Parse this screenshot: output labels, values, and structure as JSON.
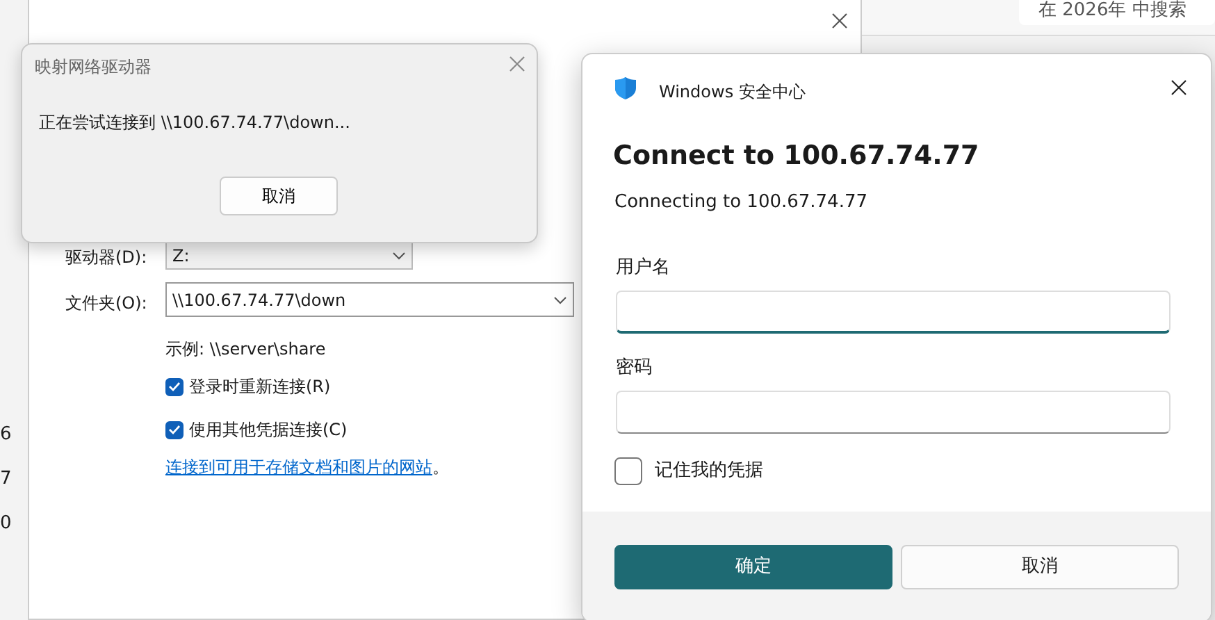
{
  "background": {
    "search_field": {
      "placeholder": "在 2026年 中搜索"
    },
    "side_numbers": [
      "6",
      "7",
      "0"
    ]
  },
  "map_drive_window": {
    "drive_label": "驱动器(D):",
    "drive_value": "Z:",
    "folder_label": "文件夹(O):",
    "folder_value": "\\\\100.67.74.77\\down",
    "example": "示例: \\\\server\\share",
    "options": [
      {
        "label": "登录时重新连接(R)",
        "checked": true
      },
      {
        "label": "使用其他凭据连接(C)",
        "checked": true
      }
    ],
    "link": "连接到可用于存储文档和图片的网站",
    "link_suffix": "。"
  },
  "progress_dialog": {
    "title": "映射网络驱动器",
    "message": "正在尝试连接到 \\\\100.67.74.77\\down...",
    "button": "取消"
  },
  "security_dialog": {
    "app_title": "Windows 安全中心",
    "heading": "Connect to 100.67.74.77",
    "subheading": "Connecting to 100.67.74.77",
    "fields": [
      {
        "label": "用户名",
        "focused": true
      },
      {
        "label": "密码",
        "focused": false
      }
    ],
    "remember": {
      "label": "记住我的凭据",
      "checked": false
    },
    "buttons": [
      {
        "label": "确定",
        "kind": "primary"
      },
      {
        "label": "取消",
        "kind": "secondary"
      }
    ]
  }
}
